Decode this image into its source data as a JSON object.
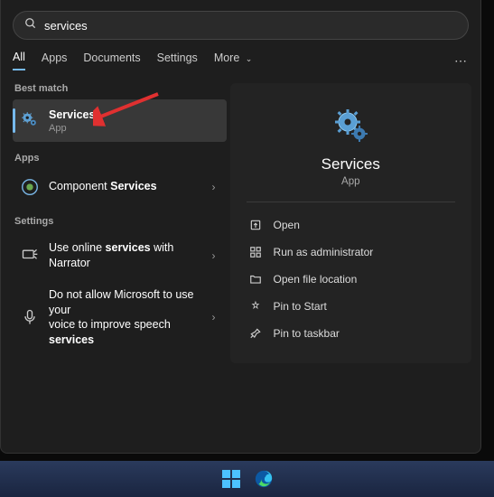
{
  "search": {
    "placeholder": "",
    "value": "services"
  },
  "tabs": {
    "all": "All",
    "apps": "Apps",
    "documents": "Documents",
    "settings": "Settings",
    "more": "More"
  },
  "left": {
    "best_match_label": "Best match",
    "best_match": {
      "title": "Services",
      "subtitle": "App"
    },
    "apps_label": "Apps",
    "apps": [
      {
        "pre": "Component ",
        "bold": "Services"
      }
    ],
    "settings_label": "Settings",
    "settings": [
      {
        "pre": "Use online ",
        "bold": "services",
        "post": " with Narrator"
      },
      {
        "line1": "Do not allow Microsoft to use your",
        "line2_pre": "voice to improve speech ",
        "line2_bold": "services"
      }
    ]
  },
  "details": {
    "title": "Services",
    "subtitle": "App",
    "actions": {
      "open": "Open",
      "run_admin": "Run as administrator",
      "open_location": "Open file location",
      "pin_start": "Pin to Start",
      "pin_taskbar": "Pin to taskbar"
    }
  }
}
